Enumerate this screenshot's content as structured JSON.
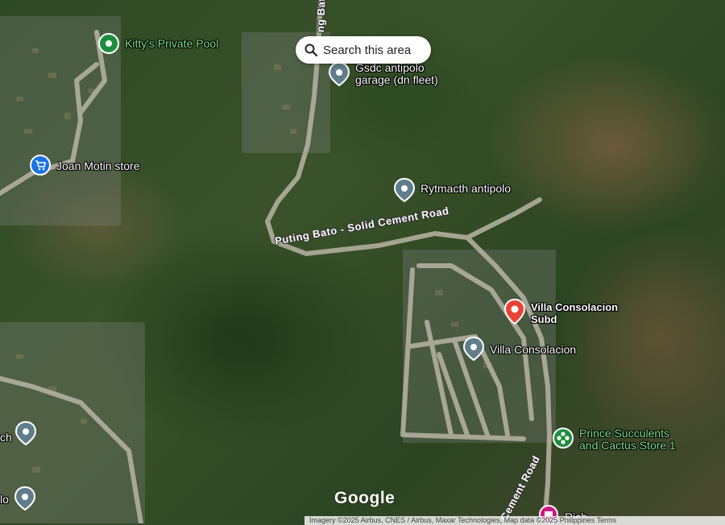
{
  "search_button": {
    "label": "Search this area"
  },
  "places": [
    {
      "label": "Kitty's Private Pool",
      "icon": "pool-pin-icon"
    },
    {
      "label": "Gsdc antipolo\ngarage (dn fleet)",
      "icon": "place-pin-icon"
    },
    {
      "label": "Joan Motin store",
      "icon": "shopping-cart-pin-icon"
    },
    {
      "label": "Rytmacth antipolo",
      "icon": "place-pin-icon"
    },
    {
      "label": "Villa Consolacion\nSubd",
      "icon": "red-location-pin-icon"
    },
    {
      "label": "Villa Consolacion",
      "icon": "place-pin-icon"
    },
    {
      "label": "Prince Succulents\nand Cactus Store 1",
      "icon": "plant-store-pin-icon"
    },
    {
      "label": "Rich",
      "icon": "hotel-pin-icon"
    },
    {
      "label": "ch",
      "icon": "place-pin-icon"
    },
    {
      "label": "lo",
      "icon": "place-pin-icon"
    }
  ],
  "roads": {
    "main": "Puting Bato - Solid Cement Road",
    "north": "ng Bato",
    "south": "Cement Road"
  },
  "branding": {
    "logo": "Google"
  },
  "attribution": "Imagery ©2025 Airbus, CNES / Airbus, Maxar Technologies, Map data ©2025    Philippines    Terms",
  "colors": {
    "pin_grey": "#607d8b",
    "pin_green": "#1e8e3e",
    "pin_blue": "#1a73e8",
    "pin_red": "#ea4335",
    "pin_pink": "#d01884",
    "road": "#c9c4b5"
  }
}
